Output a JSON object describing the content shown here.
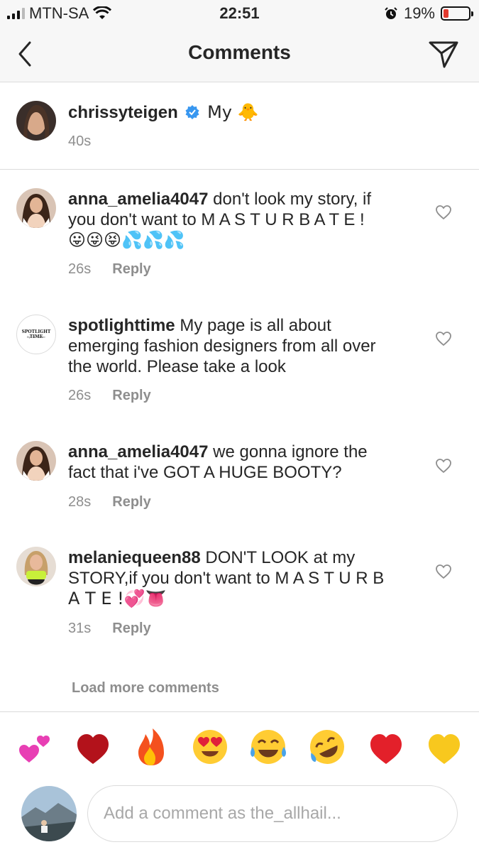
{
  "status_bar": {
    "carrier": "MTN-SA",
    "time": "22:51",
    "battery": "19%",
    "battery_level": 0.19,
    "icons": [
      "signal-icon",
      "wifi-icon",
      "alarm-icon",
      "battery-icon"
    ]
  },
  "nav": {
    "title": "Comments",
    "icons": [
      "back-chevron-icon",
      "direct-send-icon"
    ]
  },
  "caption": {
    "username": "chrissyteigen",
    "verified": true,
    "text": "My 🐥",
    "time": "40s"
  },
  "comments": [
    {
      "username": "anna_amelia4047",
      "line1": " don't look  my story, if",
      "line2": "you don't want to  M A S T U R B A T E !",
      "line3": "😛😜😝💦💦💦",
      "time": "26s",
      "reply": "Reply"
    },
    {
      "username": "spotlighttime",
      "line1": " My page is all about",
      "line2": "emerging fashion designers from all over",
      "line3": "the world. Please take a look",
      "avatar_text": "SPOTLIGHT TIME",
      "avatar_subtext": "By Ofri Gutterr",
      "time": "26s",
      "reply": "Reply"
    },
    {
      "username": "anna_amelia4047",
      "line1": " we gonna ignore the",
      "line2": "fact that i've GOT A HUGE BOOTY?",
      "time": "28s",
      "reply": "Reply"
    },
    {
      "username": "melaniequeen88",
      "line1": " DON'T LOOK at my",
      "line2": "STORY,if you don't want to M A S T U R B",
      "line3": "A T E !💞👅",
      "time": "31s",
      "reply": "Reply"
    }
  ],
  "load_more": "Load more comments",
  "quick_emojis": [
    "💕",
    "❤️",
    "🔥",
    "😍",
    "😂",
    "🤣",
    "❤️",
    "💛"
  ],
  "input": {
    "placeholder": "Add a comment as the_allhail..."
  },
  "colors": {
    "text": "#262626",
    "secondary": "#8e8e8e",
    "verified_blue": "#3897f0",
    "divider": "#dbdbdb",
    "battery_low": "#e23a2f"
  }
}
